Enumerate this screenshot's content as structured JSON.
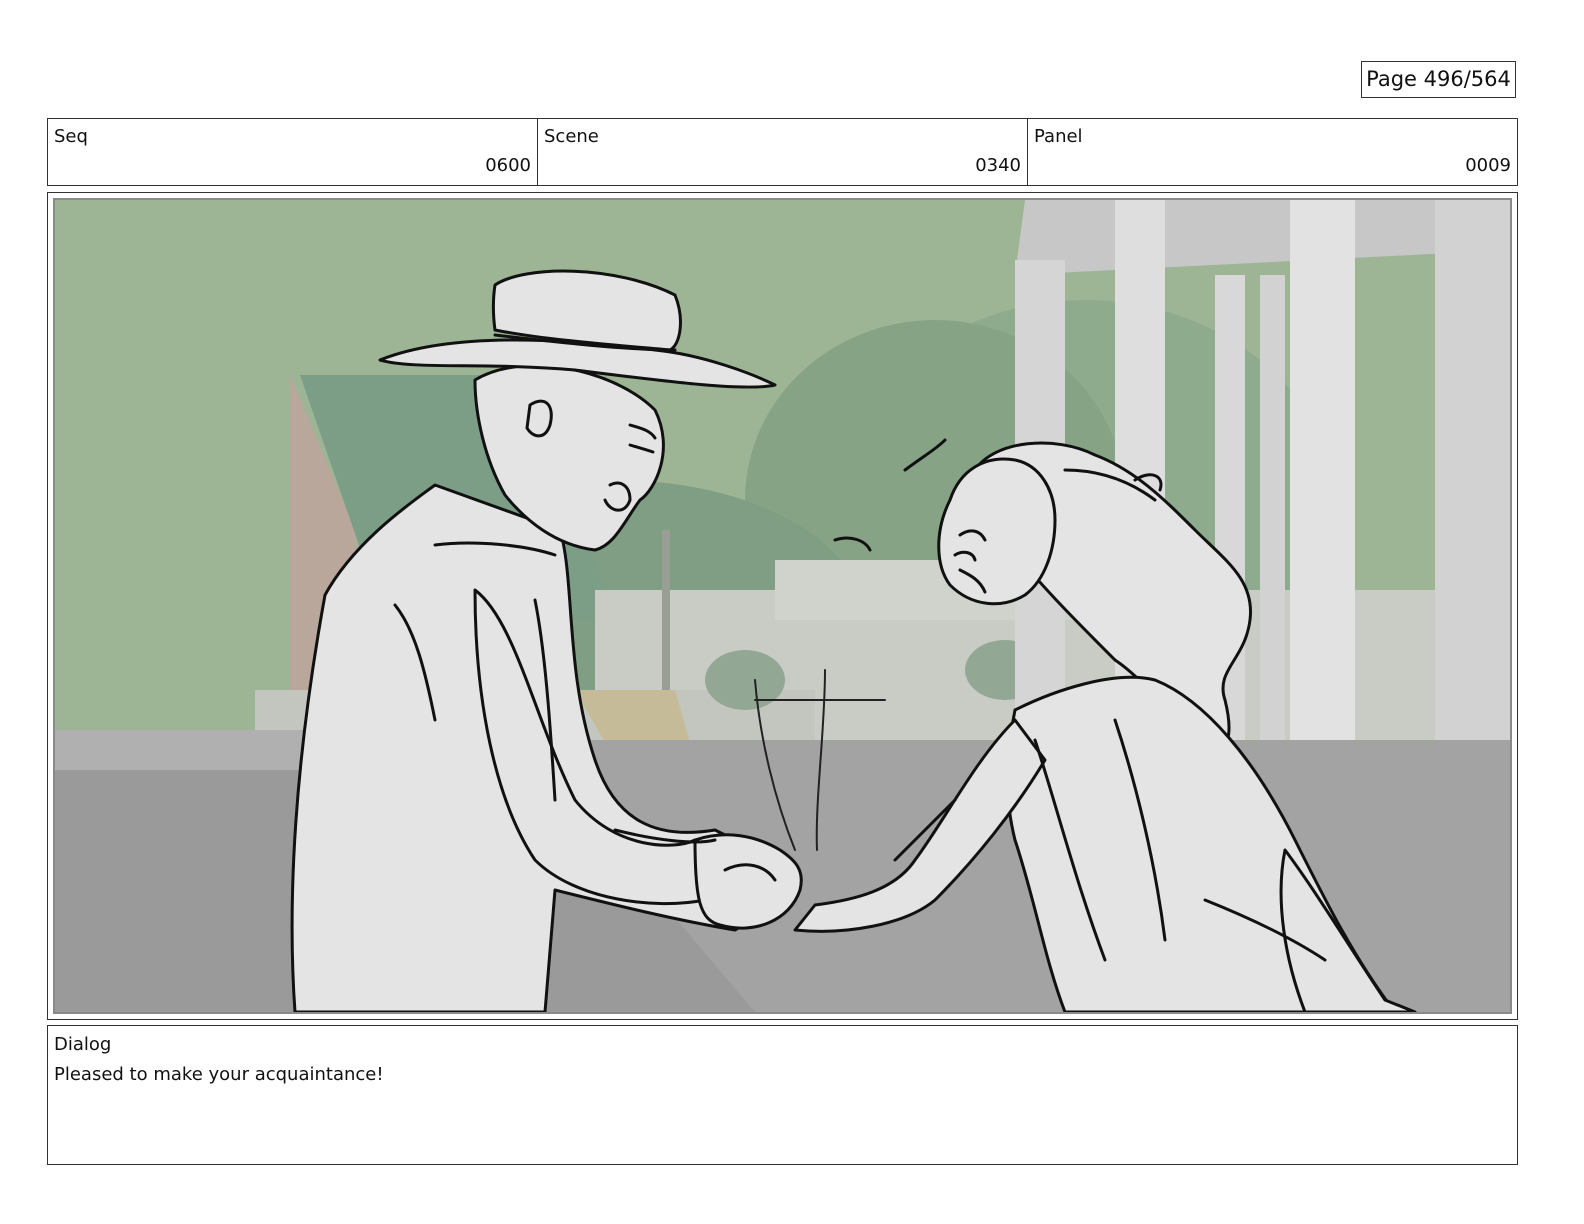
{
  "page": {
    "number_label": "Page 496/564"
  },
  "header": {
    "seq": {
      "label": "Seq",
      "value": "0600"
    },
    "scene": {
      "label": "Scene",
      "value": "0340"
    },
    "panel": {
      "label": "Panel",
      "value": "0009"
    }
  },
  "panel_image": {
    "icon": "storyboard-sketch-handshake",
    "colors": {
      "sky_green": "#9db595",
      "dome_green": "#7f9e84",
      "building_gray": "#c9ccc4",
      "pillar_white": "#dcdcdc",
      "ground_gray": "#9a9a9a",
      "figure_fill": "#e4e4e4",
      "line": "#111111"
    }
  },
  "dialog": {
    "label": "Dialog",
    "text": "Pleased to make your acquaintance!"
  }
}
